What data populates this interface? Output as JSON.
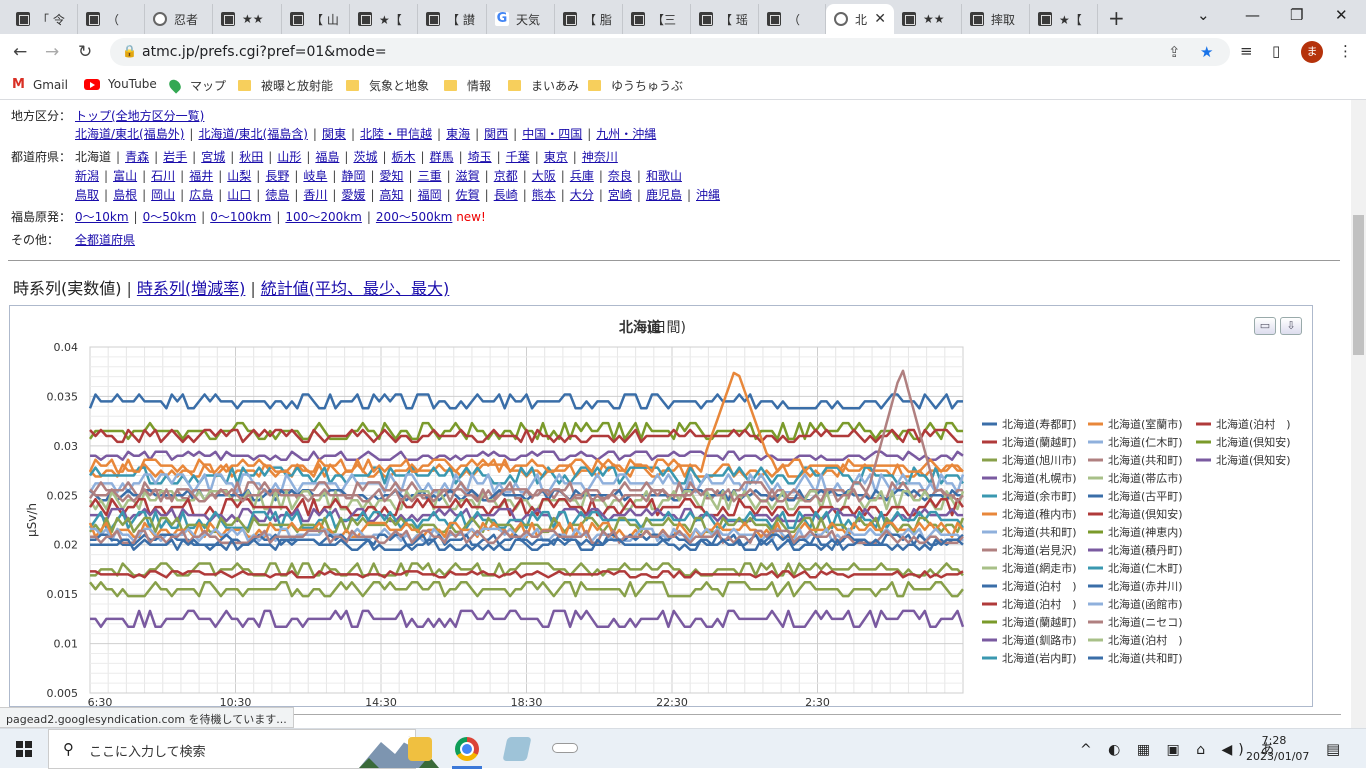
{
  "browser": {
    "tabs": [
      {
        "title": "「 令",
        "icon": "atmc"
      },
      {
        "title": "（ ",
        "icon": "atmc"
      },
      {
        "title": "忍者",
        "icon": "globe"
      },
      {
        "title": "★★",
        "icon": "atmc"
      },
      {
        "title": "【 山",
        "icon": "atmc"
      },
      {
        "title": "★【",
        "icon": "atmc"
      },
      {
        "title": "【 讃",
        "icon": "atmc"
      },
      {
        "title": "天気",
        "icon": "g"
      },
      {
        "title": "【 脂",
        "icon": "atmc"
      },
      {
        "title": "【三",
        "icon": "atmc"
      },
      {
        "title": "【 瑶",
        "icon": "atmc"
      },
      {
        "title": "（ ",
        "icon": "atmc"
      },
      {
        "title": "北",
        "icon": "globe",
        "active": true
      },
      {
        "title": "★★",
        "icon": "atmc"
      },
      {
        "title": "摔取",
        "icon": "atmc"
      },
      {
        "title": "★【",
        "icon": "atmc"
      }
    ],
    "url": "atmc.jp/prefs.cgi?pref=01&mode=",
    "avatar_initial": "ま",
    "bookmarks": [
      {
        "label": "Gmail",
        "icon": "gmail"
      },
      {
        "label": "YouTube",
        "icon": "youtube"
      },
      {
        "label": "マップ",
        "icon": "maps"
      },
      {
        "label": "被曝と放射能",
        "icon": "folder"
      },
      {
        "label": "気象と地象",
        "icon": "folder"
      },
      {
        "label": "情報",
        "icon": "folder"
      },
      {
        "label": "まいあみ",
        "icon": "folder"
      },
      {
        "label": "ゆうちゅうぶ",
        "icon": "folder"
      }
    ],
    "status_text": "pagead2.googlesyndication.com を待機しています..."
  },
  "nav": {
    "region_label": "地方区分：",
    "region_top": "トップ(全地方区分一覧)",
    "regions": [
      "北海道/東北(福島外)",
      "北海道/東北(福島含)",
      "関東",
      "北陸・甲信越",
      "東海",
      "関西",
      "中国・四国",
      "九州・沖縄"
    ],
    "pref_label": "都道府県：",
    "prefs_row1": [
      "北海道",
      "青森",
      "岩手",
      "宮城",
      "秋田",
      "山形",
      "福島",
      "茨城",
      "栃木",
      "群馬",
      "埼玉",
      "千葉",
      "東京",
      "神奈川"
    ],
    "prefs_row2": [
      "新潟",
      "富山",
      "石川",
      "福井",
      "山梨",
      "長野",
      "岐阜",
      "静岡",
      "愛知",
      "三重",
      "滋賀",
      "京都",
      "大阪",
      "兵庫",
      "奈良",
      "和歌山"
    ],
    "prefs_row3": [
      "鳥取",
      "島根",
      "岡山",
      "広島",
      "山口",
      "徳島",
      "香川",
      "愛媛",
      "高知",
      "福岡",
      "佐賀",
      "長崎",
      "熊本",
      "大分",
      "宮崎",
      "鹿児島",
      "沖縄"
    ],
    "fuku_label": "福島原発：",
    "fuku_links": [
      "0～10km",
      "0～50km",
      "0～100km",
      "100～200km",
      "200～500km"
    ],
    "new_mark": "new!",
    "other_label": "その他：",
    "other_link": "全都道府県"
  },
  "view_tabs": {
    "current": "時系列(実数値)",
    "links": [
      "時系列(増減率)",
      "統計値(平均、最少、最大)"
    ]
  },
  "chart_data": {
    "type": "line",
    "title": "北海道",
    "subtitle": "(日間)",
    "ylabel": "μSv/h",
    "xlabel": "",
    "ylim": [
      0.005,
      0.04
    ],
    "yticks": [
      "0.04",
      "0.035",
      "0.03",
      "0.025",
      "0.02",
      "0.015",
      "0.01",
      "0.005"
    ],
    "xtick_labels": [
      "6:30",
      "10:30",
      "14:30",
      "18:30",
      "22:30",
      "2:30"
    ],
    "legend_position": "right",
    "grid": true,
    "legend": [
      {
        "name": "北海道(寿都町)",
        "color": "#3a6ea8"
      },
      {
        "name": "北海道(室蘭市)",
        "color": "#e8873a"
      },
      {
        "name": "北海道(泊村　)",
        "color": "#b03a3a"
      },
      {
        "name": "北海道(蘭越町)",
        "color": "#b03a3a"
      },
      {
        "name": "北海道(仁木町)",
        "color": "#8fb0dc"
      },
      {
        "name": "北海道(倶知安)",
        "color": "#7a9a2a"
      },
      {
        "name": "北海道(旭川市)",
        "color": "#88a04a"
      },
      {
        "name": "北海道(共和町)",
        "color": "#b08080"
      },
      {
        "name": "北海道(倶知安)",
        "color": "#7a5aa0"
      },
      {
        "name": "北海道(札幌市)",
        "color": "#7a5aa0"
      },
      {
        "name": "北海道(帯広市)",
        "color": "#a8c088"
      },
      {
        "name": "北海道(余市町)",
        "color": "#3a98b0"
      },
      {
        "name": "北海道(古平町)",
        "color": "#3a6ea8"
      },
      {
        "name": "北海道(稚内市)",
        "color": "#e8873a"
      },
      {
        "name": "北海道(倶知安)",
        "color": "#b03a3a"
      },
      {
        "name": "北海道(共和町)",
        "color": "#8fb0dc"
      },
      {
        "name": "北海道(神恵内)",
        "color": "#7a9a2a"
      },
      {
        "name": "北海道(岩見沢)",
        "color": "#b08080"
      },
      {
        "name": "北海道(積丹町)",
        "color": "#7a5aa0"
      },
      {
        "name": "北海道(網走市)",
        "color": "#a8c088"
      },
      {
        "name": "北海道(仁木町)",
        "color": "#3a98b0"
      },
      {
        "name": "北海道(泊村　)",
        "color": "#3a6ea8"
      },
      {
        "name": "北海道(赤井川)",
        "color": "#3a6ea8"
      },
      {
        "name": "北海道(泊村　)",
        "color": "#b03a3a"
      },
      {
        "name": "北海道(函館市)",
        "color": "#8fb0dc"
      },
      {
        "name": "北海道(蘭越町)",
        "color": "#7a9a2a"
      },
      {
        "name": "北海道(ニセコ)",
        "color": "#b08080"
      },
      {
        "name": "北海道(釧路市)",
        "color": "#7a5aa0"
      },
      {
        "name": "北海道(泊村　)",
        "color": "#a8c088"
      },
      {
        "name": "北海道(岩内町)",
        "color": "#3a98b0"
      },
      {
        "name": "北海道(共和町)",
        "color": "#3a6ea8"
      }
    ],
    "series_levels": [
      {
        "color": "#3a6ea8",
        "base": 0.0345,
        "amp": 0.0007
      },
      {
        "color": "#7a9a2a",
        "base": 0.0315,
        "amp": 0.0008
      },
      {
        "color": "#b03a3a",
        "base": 0.031,
        "amp": 0.0006
      },
      {
        "color": "#7a5aa0",
        "base": 0.029,
        "amp": 0.0004
      },
      {
        "color": "#e8873a",
        "base": 0.0275,
        "amp": 0.0006
      },
      {
        "color": "#3a98b0",
        "base": 0.027,
        "amp": 0.0008
      },
      {
        "color": "#8fb0dc",
        "base": 0.0262,
        "amp": 0.0009
      },
      {
        "color": "#b08080",
        "base": 0.0255,
        "amp": 0.0008
      },
      {
        "color": "#3a6ea8",
        "base": 0.025,
        "amp": 0.0005
      },
      {
        "color": "#a8c088",
        "base": 0.0245,
        "amp": 0.0009
      },
      {
        "color": "#b03a3a",
        "base": 0.0238,
        "amp": 0.0008
      },
      {
        "color": "#7a5aa0",
        "base": 0.023,
        "amp": 0.0006
      },
      {
        "color": "#3a98b0",
        "base": 0.0225,
        "amp": 0.0008
      },
      {
        "color": "#88a04a",
        "base": 0.022,
        "amp": 0.0007
      },
      {
        "color": "#e8873a",
        "base": 0.0215,
        "amp": 0.0007
      },
      {
        "color": "#8fb0dc",
        "base": 0.021,
        "amp": 0.0006
      },
      {
        "color": "#3a6ea8",
        "base": 0.0205,
        "amp": 0.0005
      },
      {
        "color": "#b08080",
        "base": 0.0208,
        "amp": 0.0006
      },
      {
        "color": "#3a6ea8",
        "base": 0.02,
        "amp": 0.0005
      },
      {
        "color": "#88a04a",
        "base": 0.0175,
        "amp": 0.0006
      },
      {
        "color": "#b03a3a",
        "base": 0.017,
        "amp": 0.0003
      },
      {
        "color": "#88a04a",
        "base": 0.0155,
        "amp": 0.0007
      },
      {
        "color": "#7a5aa0",
        "base": 0.0125,
        "amp": 0.0008
      }
    ],
    "peaks": [
      {
        "color": "#e8873a",
        "base": 0.028,
        "peak": 0.038,
        "at": 0.74
      },
      {
        "color": "#b08080",
        "base": 0.025,
        "peak": 0.038,
        "at": 0.93
      }
    ]
  },
  "taskbar": {
    "search_placeholder": "ここに入力して検索",
    "time": "7:28",
    "date": "2023/01/07",
    "ime": "あ"
  }
}
